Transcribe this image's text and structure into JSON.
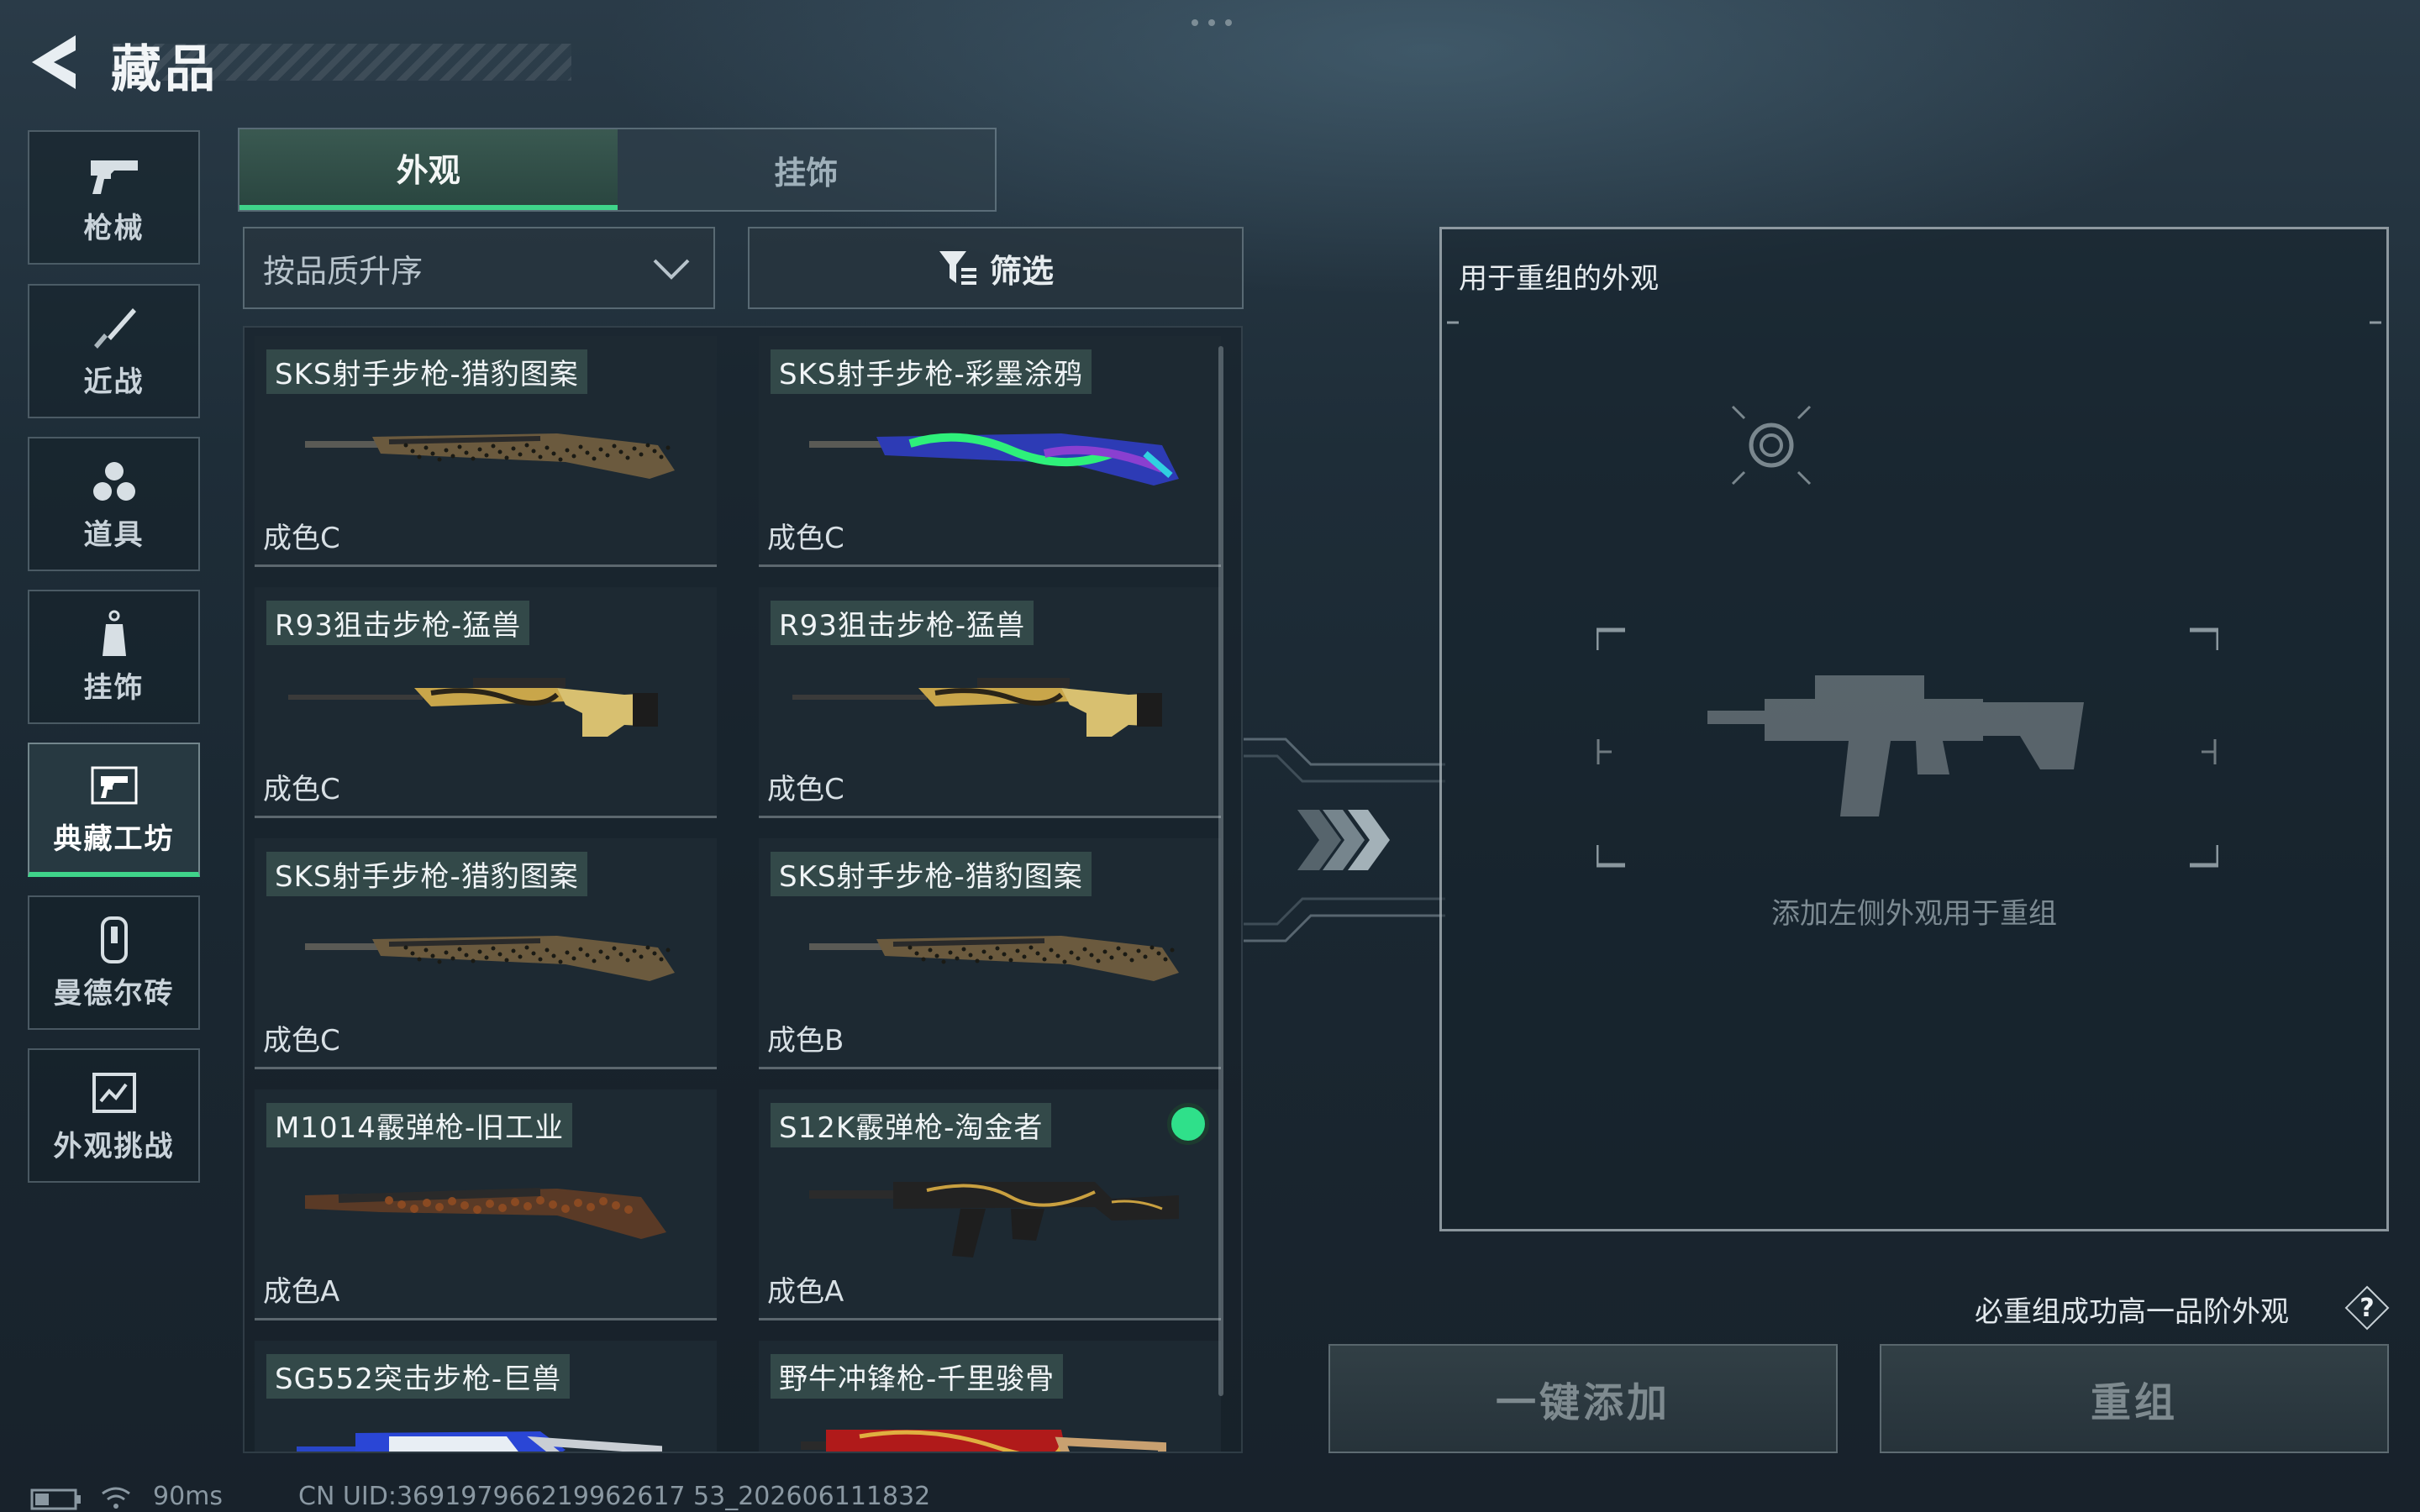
{
  "header": {
    "title": "藏品"
  },
  "sidebar": {
    "items": [
      {
        "label": "枪械",
        "icon": "pistol-icon",
        "active": false
      },
      {
        "label": "近战",
        "icon": "knife-icon",
        "active": false
      },
      {
        "label": "道具",
        "icon": "grenades-icon",
        "active": false
      },
      {
        "label": "挂饰",
        "icon": "charm-icon",
        "active": false
      },
      {
        "label": "典藏工坊",
        "icon": "workshop-icon",
        "active": true
      },
      {
        "label": "曼德尔砖",
        "icon": "mandel-brick-icon",
        "active": false
      },
      {
        "label": "外观挑战",
        "icon": "challenge-icon",
        "active": false
      }
    ]
  },
  "tabs": [
    {
      "label": "外观",
      "active": true
    },
    {
      "label": "挂饰",
      "active": false
    }
  ],
  "sort": {
    "value": "按品质升序"
  },
  "filter": {
    "label": "筛选"
  },
  "items": [
    {
      "name": "SKS射手步枪-猎豹图案",
      "grade": "成色C",
      "skin": "leopard",
      "selected": false
    },
    {
      "name": "SKS射手步枪-彩墨涂鸦",
      "grade": "成色C",
      "skin": "graffiti",
      "selected": false
    },
    {
      "name": "R93狙击步枪-猛兽",
      "grade": "成色C",
      "skin": "beast",
      "selected": false
    },
    {
      "name": "R93狙击步枪-猛兽",
      "grade": "成色C",
      "skin": "beast",
      "selected": false
    },
    {
      "name": "SKS射手步枪-猎豹图案",
      "grade": "成色C",
      "skin": "leopard",
      "selected": false
    },
    {
      "name": "SKS射手步枪-猎豹图案",
      "grade": "成色B",
      "skin": "leopard",
      "selected": false
    },
    {
      "name": "M1014霰弹枪-旧工业",
      "grade": "成色A",
      "skin": "rust",
      "selected": false
    },
    {
      "name": "S12K霰弹枪-淘金者",
      "grade": "成色A",
      "skin": "gold-black",
      "selected": true
    },
    {
      "name": "SG552突击步枪-巨兽",
      "grade": "",
      "skin": "blue-white",
      "selected": false
    },
    {
      "name": "野牛冲锋枪-千里骏骨",
      "grade": "",
      "skin": "red-gold",
      "selected": false
    }
  ],
  "panel": {
    "title": "用于重组的外观",
    "hint": "添加左侧外观用于重组"
  },
  "guarantee_text": "必重组成功高一品阶外观",
  "buttons": {
    "quick_add": "一键添加",
    "recombine": "重组"
  },
  "status": {
    "ping": "90ms",
    "uid": "CN UID:369197966219962617 53_202606111832"
  },
  "colors": {
    "accent": "#3fd48a",
    "panel_border": "#bec8cd"
  }
}
